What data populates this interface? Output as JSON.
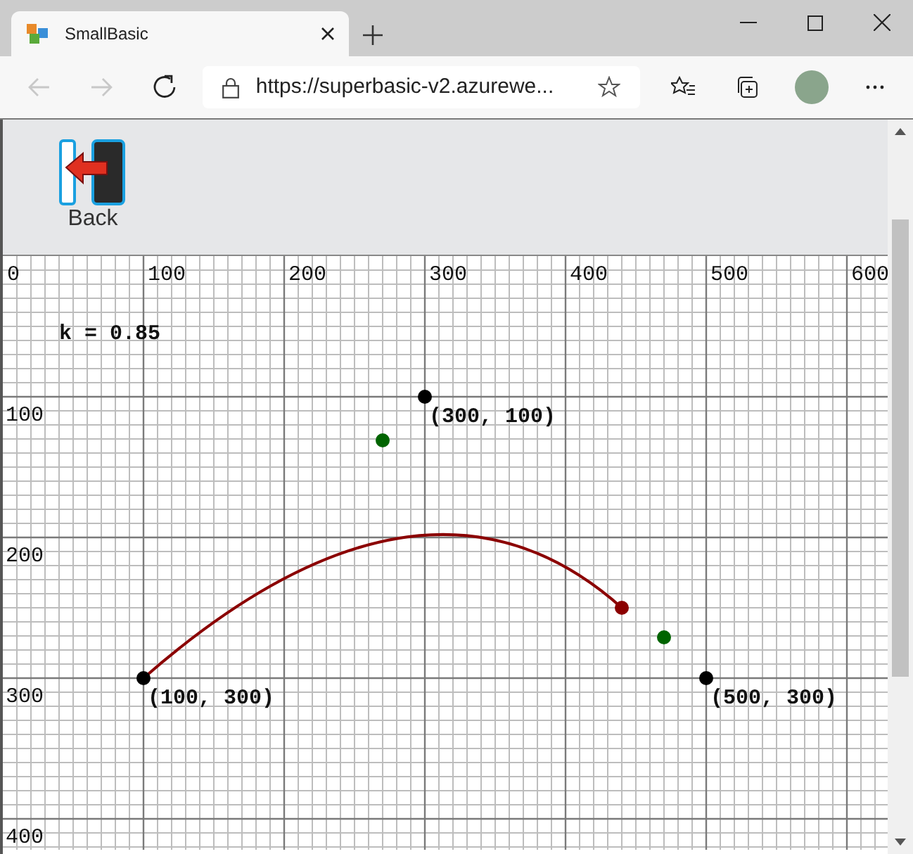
{
  "browser": {
    "tab": {
      "title": "SmallBasic",
      "selected": true
    },
    "address": "https://superbasic-v2.azurewe..."
  },
  "toolbar": {
    "buttons": [
      {
        "label": "Back"
      }
    ]
  },
  "canvas": {
    "x_labels": [
      "0",
      "100",
      "200",
      "300",
      "400",
      "500",
      "600"
    ],
    "y_labels": [
      "100",
      "200",
      "300",
      "400"
    ],
    "k_label": "k = 0.85",
    "points": [
      {
        "label": "(300, 100)",
        "color": "#000000"
      },
      {
        "label": "(100, 300)",
        "color": "#000000"
      },
      {
        "label": "(500, 300)",
        "color": "#000000"
      },
      {
        "color": "#006400"
      },
      {
        "color": "#006400"
      },
      {
        "color": "#8b0000"
      }
    ]
  }
}
